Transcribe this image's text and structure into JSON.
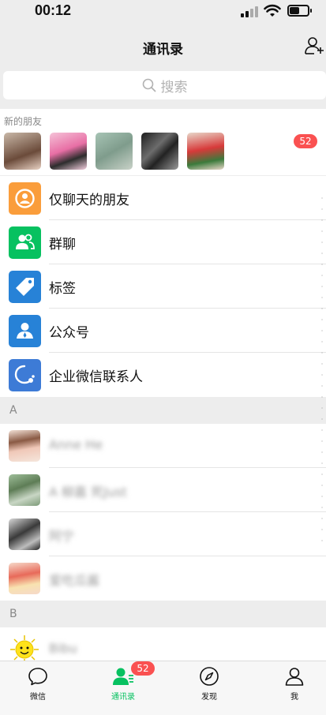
{
  "status_bar": {
    "time": "00:12",
    "battery_level": 0.55
  },
  "nav": {
    "title": "通讯录",
    "add_friend_icon": "add-contact-icon"
  },
  "search": {
    "placeholder": "搜索",
    "icon": "search-icon"
  },
  "new_friends": {
    "label": "新的朋友",
    "badge": "52",
    "avatar_count": 5
  },
  "functions": [
    {
      "label": "仅聊天的朋友",
      "icon": "chat-only-friends-icon",
      "color": "#fa9d3b"
    },
    {
      "label": "群聊",
      "icon": "group-chat-icon",
      "color": "#07c160"
    },
    {
      "label": "标签",
      "icon": "tag-icon",
      "color": "#2782d7"
    },
    {
      "label": "公众号",
      "icon": "official-account-icon",
      "color": "#2782d7"
    },
    {
      "label": "企业微信联系人",
      "icon": "wecom-contacts-icon",
      "color": "#3d7bd6"
    }
  ],
  "sections": [
    {
      "letter": "A",
      "contacts": [
        {
          "name": "Anne He"
        },
        {
          "name": "A 柳嘉 死Just"
        },
        {
          "name": "阿宁"
        },
        {
          "name": "爱吃瓜酱"
        }
      ]
    },
    {
      "letter": "B",
      "contacts": [
        {
          "name": "Bibu"
        }
      ]
    }
  ],
  "tabbar": {
    "tabs": [
      {
        "label": "微信",
        "icon": "chat-bubble-icon",
        "active": false
      },
      {
        "label": "通讯录",
        "icon": "contacts-icon",
        "active": true
      },
      {
        "label": "发现",
        "icon": "compass-icon",
        "active": false
      },
      {
        "label": "我",
        "icon": "profile-icon",
        "active": false
      }
    ],
    "contacts_badge": "52"
  },
  "colors": {
    "accent": "#07c160",
    "badge": "#fa5151",
    "background": "#ededed"
  }
}
